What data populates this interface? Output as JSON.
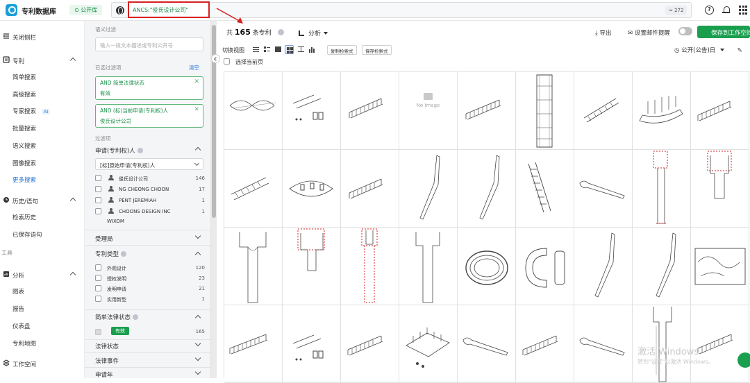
{
  "topbar": {
    "brand": "专利数据库",
    "library_tag": "公开库",
    "query": "ANCS:\"俊氏设计公司\"",
    "result_count_badge": "≈ 272"
  },
  "leftnav": {
    "collapse": "关闭侧栏",
    "patent_group": "专利",
    "patent_items": [
      "简单搜索",
      "高级搜索",
      "专家搜索",
      "批量搜索",
      "语义搜索",
      "图像搜索",
      "更多搜索"
    ],
    "ai_badge": "AI",
    "history_group": "历史/语句",
    "history_items": [
      "检索历史",
      "已保存语句"
    ],
    "tools_label": "工具",
    "analysis_group": "分析",
    "analysis_items": [
      "图表",
      "报告",
      "仪表盘",
      "专利地图"
    ],
    "workspace": "工作空间"
  },
  "filter": {
    "semantic_label": "语义过滤",
    "semantic_placeholder": "输入一段文本描述或专利公开号",
    "selected_label": "已选过滤项",
    "clear": "清空",
    "selected": [
      {
        "line1": "AND 简单法律状态",
        "line2": "有效"
      },
      {
        "line1": "AND (标)当前申请(专利权)人",
        "line2": "俊氏设计公司"
      }
    ],
    "filter_label": "过滤项",
    "applicant_head": "申请(专利权)人",
    "applicant_select": "[标]原始申请(专利权)人",
    "applicants": [
      {
        "name": "俊氏设计公司",
        "count": "146"
      },
      {
        "name": "NG CHEONG CHOON",
        "count": "17"
      },
      {
        "name": "PENT JEREMIAH",
        "count": "1"
      },
      {
        "name": "CHOONS DESIGN INC",
        "count": "1"
      }
    ],
    "applicant_more": "WIXOM",
    "office_head": "受理局",
    "type_head": "专利类型",
    "types": [
      {
        "name": "外观设计",
        "count": "120"
      },
      {
        "name": "授权发明",
        "count": "23"
      },
      {
        "name": "发明申请",
        "count": "21"
      },
      {
        "name": "实用新型",
        "count": "1"
      }
    ],
    "legal_head": "简单法律状态",
    "legal_valid": "有效",
    "legal_count": "165",
    "legal_status": "法律状态",
    "legal_event": "法律事件",
    "apply_year": "申请年"
  },
  "main": {
    "total_prefix": "共",
    "total": "165",
    "total_suffix": "条专利",
    "analysis": "分析",
    "export": "导出",
    "mail": "设置邮件提醒",
    "save": "保存到工作空间",
    "view_label": "切换视图",
    "copy_query": "复制检索式",
    "save_query": "保存检索式",
    "sort": "公开(公告)日",
    "select_page": "选择当前页",
    "no_image": "No Image"
  },
  "watermark": {
    "line1": "激活 Windows",
    "line2": "转到\"设置\"以激活 Windows。"
  },
  "colors": {
    "accent_green": "#1a9f4e",
    "link_blue": "#1a6fd6",
    "highlight_red": "#d62020"
  }
}
